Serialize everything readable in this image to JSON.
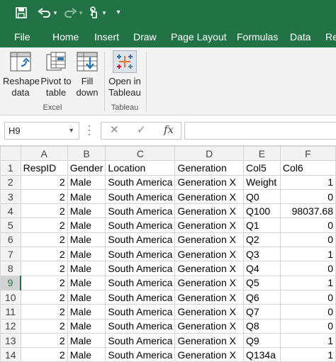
{
  "quick_access": {
    "save_icon": "save-icon",
    "undo_icon": "undo-icon",
    "redo_icon": "redo-icon",
    "touch_icon": "touch-mode-icon",
    "customize_icon": "customize-qat-icon"
  },
  "tabs": [
    "File",
    "Home",
    "Insert",
    "Draw",
    "Page Layout",
    "Formulas",
    "Data",
    "Re"
  ],
  "ribbon": {
    "excel_group": {
      "label": "Excel",
      "buttons": [
        {
          "line1": "Reshape",
          "line2": "data",
          "icon": "reshape-data-icon"
        },
        {
          "line1": "Pivot to",
          "line2": "table",
          "icon": "pivot-to-table-icon"
        },
        {
          "line1": "Fill",
          "line2": "down",
          "icon": "fill-down-icon"
        }
      ]
    },
    "tableau_group": {
      "label": "Tableau",
      "buttons": [
        {
          "line1": "Open in",
          "line2": "Tableau",
          "icon": "tableau-icon"
        }
      ]
    }
  },
  "formula_bar": {
    "name_box": "H9",
    "cancel_symbol": "✕",
    "enter_symbol": "✓",
    "fx_symbol": "fx",
    "formula": ""
  },
  "sheet": {
    "columns": [
      "A",
      "B",
      "C",
      "D",
      "E",
      "F"
    ],
    "selected_row": 9,
    "rows": [
      {
        "n": "1",
        "cells": [
          "RespID",
          "Gender",
          "Location",
          "Generation",
          "Col5",
          "Col6"
        ]
      },
      {
        "n": "2",
        "cells": [
          "2",
          "Male",
          "South America",
          "Generation X",
          "Weight",
          "1"
        ]
      },
      {
        "n": "3",
        "cells": [
          "2",
          "Male",
          "South America",
          "Generation X",
          "Q0",
          "0"
        ]
      },
      {
        "n": "4",
        "cells": [
          "2",
          "Male",
          "South America",
          "Generation X",
          "Q100",
          "98037.68"
        ]
      },
      {
        "n": "5",
        "cells": [
          "2",
          "Male",
          "South America",
          "Generation X",
          "Q1",
          "0"
        ]
      },
      {
        "n": "6",
        "cells": [
          "2",
          "Male",
          "South America",
          "Generation X",
          "Q2",
          "0"
        ]
      },
      {
        "n": "7",
        "cells": [
          "2",
          "Male",
          "South America",
          "Generation X",
          "Q3",
          "1"
        ]
      },
      {
        "n": "8",
        "cells": [
          "2",
          "Male",
          "South America",
          "Generation X",
          "Q4",
          "0"
        ]
      },
      {
        "n": "9",
        "cells": [
          "2",
          "Male",
          "South America",
          "Generation X",
          "Q5",
          "1"
        ]
      },
      {
        "n": "10",
        "cells": [
          "2",
          "Male",
          "South America",
          "Generation X",
          "Q6",
          "0"
        ]
      },
      {
        "n": "11",
        "cells": [
          "2",
          "Male",
          "South America",
          "Generation X",
          "Q7",
          "0"
        ]
      },
      {
        "n": "12",
        "cells": [
          "2",
          "Male",
          "South America",
          "Generation X",
          "Q8",
          "0"
        ]
      },
      {
        "n": "13",
        "cells": [
          "2",
          "Male",
          "South America",
          "Generation X",
          "Q9",
          "1"
        ]
      },
      {
        "n": "14",
        "cells": [
          "2",
          "Male",
          "South America",
          "Generation X",
          "Q134a",
          "1"
        ]
      }
    ]
  },
  "colors": {
    "accent": "#217346",
    "ribbon_bg": "#f3f3f3",
    "gridline": "#d4d4d4"
  }
}
